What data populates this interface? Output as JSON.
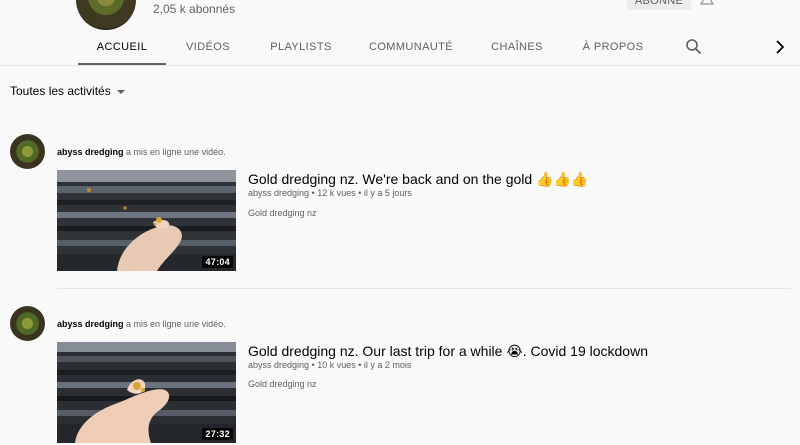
{
  "channel": {
    "subscribers": "2,05 k abonnés",
    "subscribe_label": "ABONNÉ"
  },
  "tabs": [
    {
      "label": "ACCUEIL",
      "active": true
    },
    {
      "label": "VIDÉOS",
      "active": false
    },
    {
      "label": "PLAYLISTS",
      "active": false
    },
    {
      "label": "COMMUNAUTÉ",
      "active": false
    },
    {
      "label": "CHAÎNES",
      "active": false
    },
    {
      "label": "À PROPOS",
      "active": false
    }
  ],
  "filter": {
    "label": "Toutes les activités"
  },
  "posts": [
    {
      "author": "abyss dredging",
      "action": "a mis en ligne une vidéo.",
      "title": "Gold dredging nz. We're back and on the gold 👍👍👍",
      "meta": "abyss dredging • 12 k vues • il y a 5 jours",
      "description": "Gold dredging nz",
      "duration": "47:04"
    },
    {
      "author": "abyss dredging",
      "action": "a mis en ligne une vidéo.",
      "title": "Gold dredging nz. Our last trip for a while 😭. Covid 19 lockdown",
      "meta": "abyss dredging • 10 k vues • il y a 2 mois",
      "description": "Gold dredging nz",
      "duration": "27:32"
    }
  ],
  "icons": {
    "search": "search-icon",
    "next": "chevron-right-icon",
    "bell": "bell-icon",
    "filter_caret": "caret-down-icon"
  },
  "colors": {
    "background": "#f9f9f9",
    "text_primary": "#030303",
    "text_secondary": "#606060"
  }
}
